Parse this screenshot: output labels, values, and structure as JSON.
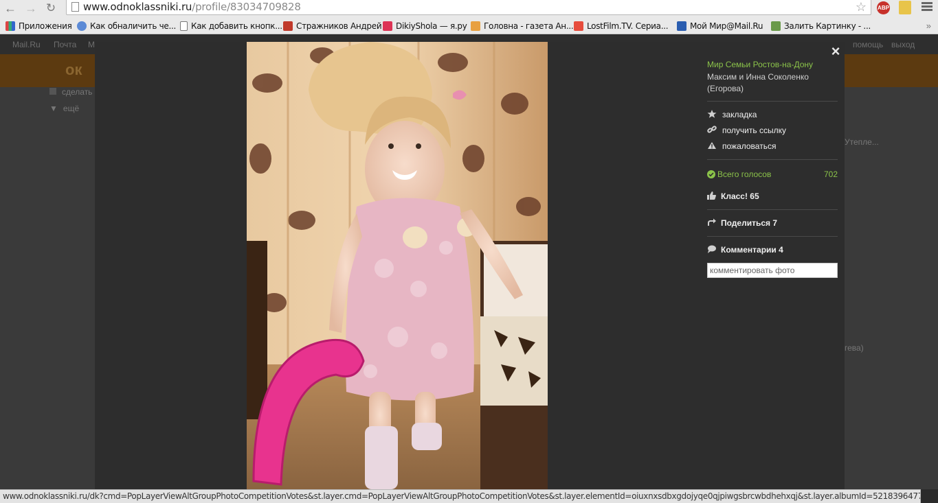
{
  "browser": {
    "url_host": "www.odnoklassniki.ru",
    "url_path": "/profile/83034709828",
    "bookmarks": [
      {
        "label": "Приложения",
        "icon": "apps-grid-icon",
        "color": "#d44"
      },
      {
        "label": "Как обналичить че...",
        "icon": "globe-icon",
        "color": "#5b8ad6"
      },
      {
        "label": "Как добавить кнопк...",
        "icon": "page-icon",
        "color": "#777"
      },
      {
        "label": "Стражников Андрей",
        "icon": "mail-m-icon",
        "color": "#c0392b"
      },
      {
        "label": "DikiyShola — я.ру",
        "icon": "yaru-icon",
        "color": "#d35"
      },
      {
        "label": "Головна - газета Ан...",
        "icon": "newspaper-icon",
        "color": "#e8a040"
      },
      {
        "label": "LostFilm.TV. Сериа...",
        "icon": "lostfilm-icon",
        "color": "#e74c3c"
      },
      {
        "label": "Мой Мир@Mail.Ru",
        "icon": "moimir-icon",
        "color": "#2a5db0"
      },
      {
        "label": "Залить Картинку - ...",
        "icon": "image-upload-icon",
        "color": "#6a9a4a"
      }
    ],
    "more_label": "»",
    "status_text": "www.odnoklassniki.ru/dk?cmd=PopLayerViewAltGroupPhotoCompetitionVotes&st.layer.cmd=PopLayerViewAltGroupPhotoCompetitionVotes&st.layer.elementId=oiuxnxsdbxgdojyqe0qjpiwgsbrcwbdhehxqj&st.layer.albumId=52183964778683&st.layer..."
  },
  "site": {
    "top_links": [
      "Mail.Ru",
      "Почта",
      "М"
    ],
    "top_right": [
      "помощь",
      "выход"
    ],
    "side_items": [
      "сделать",
      "ещё"
    ],
    "right_hints": [
      "Утепле...",
      "гева)"
    ]
  },
  "layer": {
    "close_label": "×",
    "group_name": "Мир Семьи Ростов-на-Дону",
    "author": "Максим и Инна Соколенко (Егорова)",
    "actions": {
      "bookmark": "закладка",
      "get_link": "получить ссылку",
      "report": "пожаловаться"
    },
    "votes_label": "Всего голосов",
    "votes_count": "702",
    "class_label": "Класс! 65",
    "share_label": "Поделиться 7",
    "comments_label": "Комментарии 4",
    "comment_placeholder": "комментировать фото"
  },
  "colors": {
    "accent_green": "#8bc34a",
    "layer_bg": "#2d2d2d"
  }
}
